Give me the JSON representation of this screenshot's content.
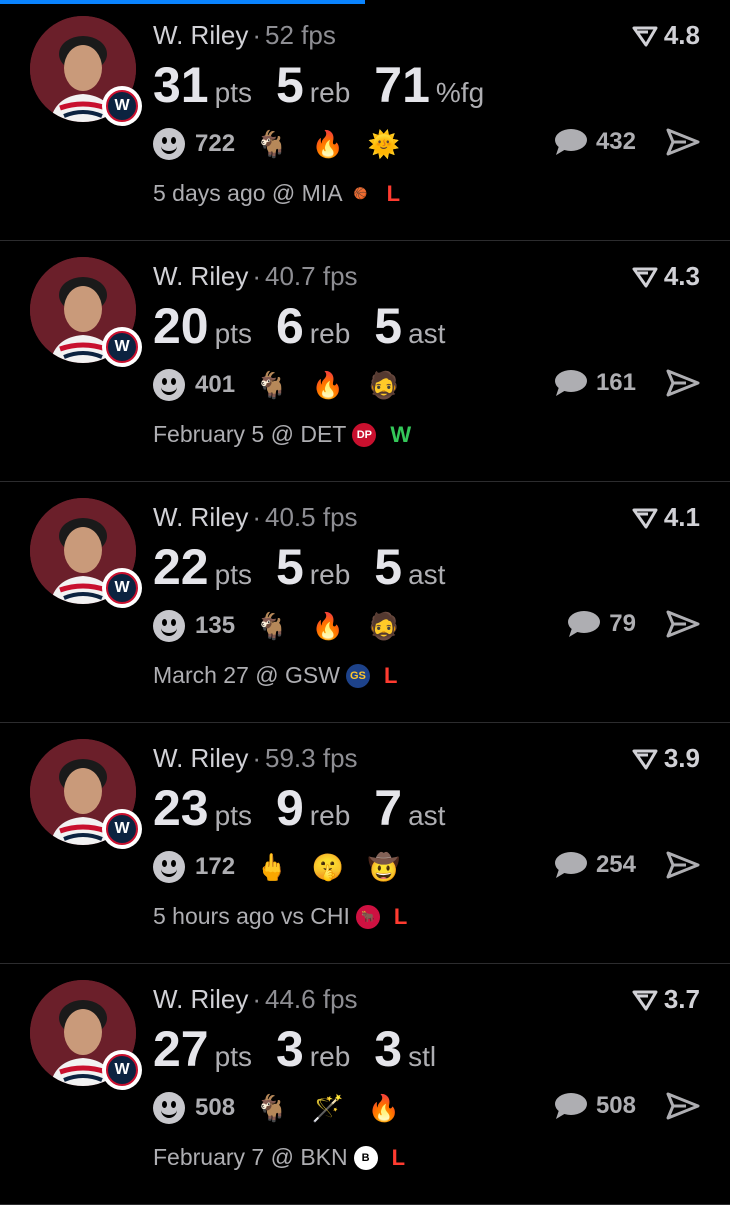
{
  "colors": {
    "accent": "#0a84ff",
    "loss": "#ff3b30",
    "win": "#34c759"
  },
  "posts": [
    {
      "player": "W. Riley",
      "fps": "52 fps",
      "rating": "4.8",
      "stats": [
        {
          "value": "31",
          "unit": "pts"
        },
        {
          "value": "5",
          "unit": "reb"
        },
        {
          "value": "71",
          "unit": "%fg"
        }
      ],
      "reaction_count": "722",
      "reactions": [
        "🐐",
        "🔥",
        "🌞"
      ],
      "comment_count": "432",
      "meta": "5 days ago @ MIA",
      "opponent_icon": "heat-logo",
      "result": "L"
    },
    {
      "player": "W. Riley",
      "fps": "40.7 fps",
      "rating": "4.3",
      "stats": [
        {
          "value": "20",
          "unit": "pts"
        },
        {
          "value": "6",
          "unit": "reb"
        },
        {
          "value": "5",
          "unit": "ast"
        }
      ],
      "reaction_count": "401",
      "reactions": [
        "🐐",
        "🔥",
        "🧔"
      ],
      "comment_count": "161",
      "meta": "February 5 @ DET",
      "opponent_icon": "pistons-logo",
      "result": "W"
    },
    {
      "player": "W. Riley",
      "fps": "40.5 fps",
      "rating": "4.1",
      "stats": [
        {
          "value": "22",
          "unit": "pts"
        },
        {
          "value": "5",
          "unit": "reb"
        },
        {
          "value": "5",
          "unit": "ast"
        }
      ],
      "reaction_count": "135",
      "reactions": [
        "🐐",
        "🔥",
        "🧔"
      ],
      "comment_count": "79",
      "meta": "March 27 @ GSW",
      "opponent_icon": "warriors-logo",
      "result": "L"
    },
    {
      "player": "W. Riley",
      "fps": "59.3 fps",
      "rating": "3.9",
      "stats": [
        {
          "value": "23",
          "unit": "pts"
        },
        {
          "value": "9",
          "unit": "reb"
        },
        {
          "value": "7",
          "unit": "ast"
        }
      ],
      "reaction_count": "172",
      "reactions": [
        "🖕",
        "🤫",
        "🤠"
      ],
      "comment_count": "254",
      "meta": "5 hours ago vs CHI",
      "opponent_icon": "bulls-logo",
      "result": "L"
    },
    {
      "player": "W. Riley",
      "fps": "44.6 fps",
      "rating": "3.7",
      "stats": [
        {
          "value": "27",
          "unit": "pts"
        },
        {
          "value": "3",
          "unit": "reb"
        },
        {
          "value": "3",
          "unit": "stl"
        }
      ],
      "reaction_count": "508",
      "reactions": [
        "🐐",
        "🪄",
        "🔥"
      ],
      "comment_count": "508",
      "meta": "February 7 @ BKN",
      "opponent_icon": "nets-logo",
      "result": "L"
    }
  ]
}
